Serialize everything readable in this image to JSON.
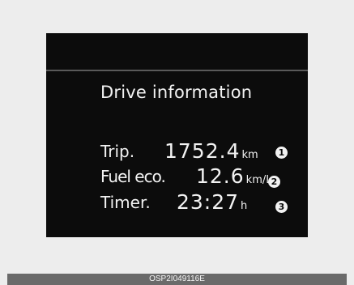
{
  "display": {
    "title": "Drive information",
    "items": [
      {
        "label": "Trip.",
        "value": "1752.4",
        "unit": "km",
        "marker": "1"
      },
      {
        "label": "Fuel eco.",
        "value": "12.6",
        "unit": "km/L",
        "marker": "2"
      },
      {
        "label": "Timer.",
        "value": "23:27",
        "unit": "h",
        "marker": "3"
      }
    ]
  },
  "footer": {
    "code": "OSP2I049116E"
  },
  "colors": {
    "page_background": "#ededed",
    "screen_background": "#0c0c0c",
    "text": "#f2f2f2",
    "footer_bar": "#6a6a6a"
  }
}
